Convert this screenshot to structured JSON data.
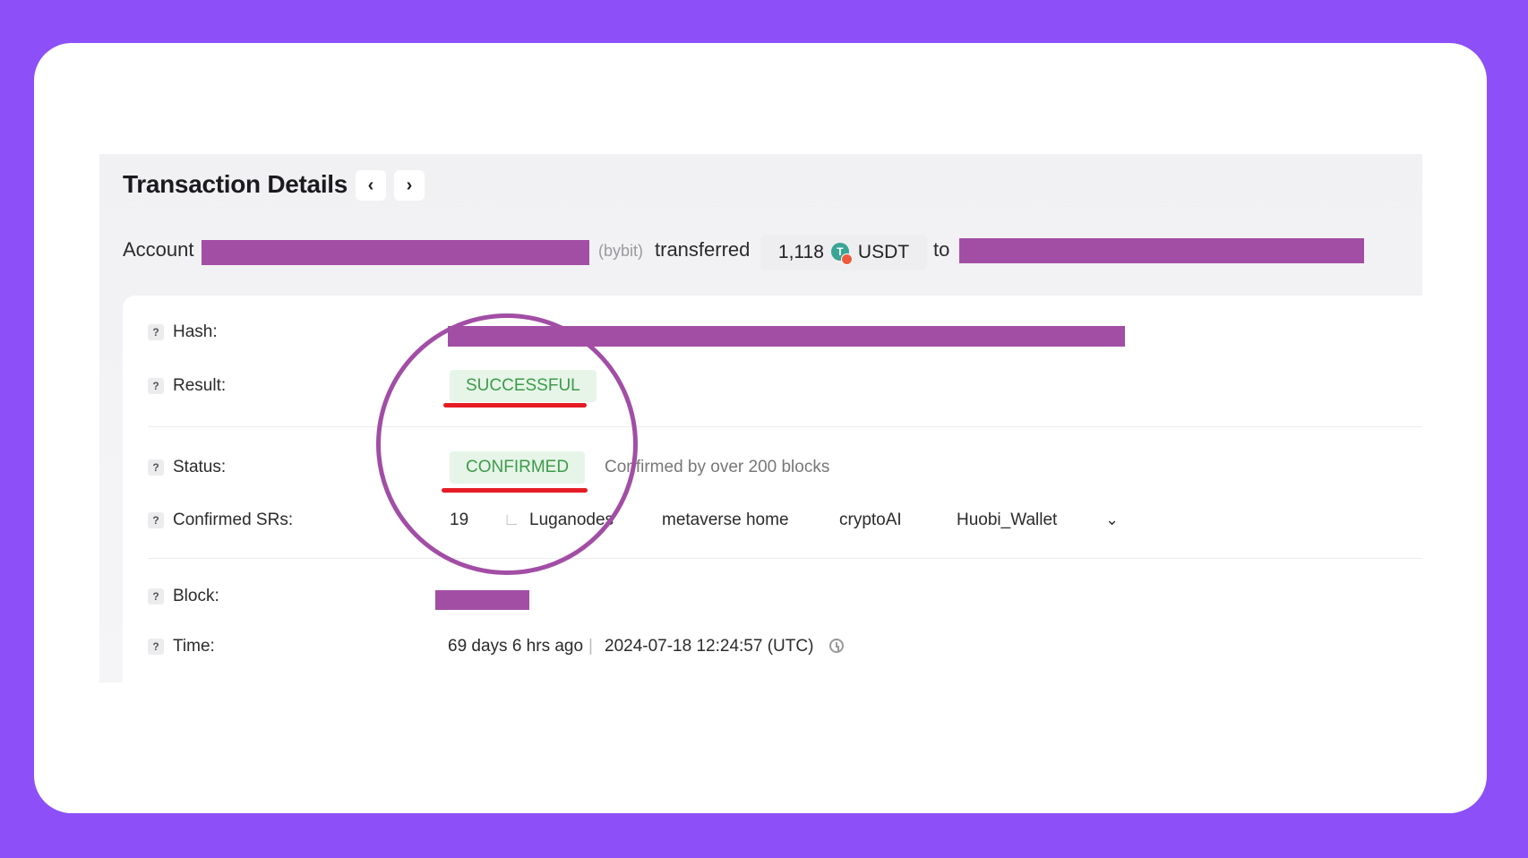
{
  "header": {
    "title": "Transaction Details",
    "prev_icon": "‹",
    "next_icon": "›"
  },
  "summary": {
    "account_label": "Account",
    "exchange_tag": "(bybit)",
    "transferred_label": "transferred",
    "amount": "1,118",
    "token": "USDT",
    "to_label": "to"
  },
  "rows": {
    "hash_label": "Hash:",
    "result_label": "Result:",
    "result_value": "SUCCESSFUL",
    "status_label": "Status:",
    "status_value": "CONFIRMED",
    "status_note": "Confirmed by over 200 blocks",
    "confirmed_srs_label": "Confirmed SRs:",
    "confirmed_srs_count": "19",
    "sr_names": [
      "Luganodes",
      "metaverse home",
      "cryptoAI",
      "Huobi_Wallet"
    ],
    "block_label": "Block:",
    "time_label": "Time:",
    "time_ago": "69 days 6 hrs ago",
    "time_separator": "|",
    "time_utc": "2024-07-18 12:24:57 (UTC)"
  },
  "colors": {
    "background": "#8c4ff8",
    "redaction": "#a24ea5",
    "success_bg": "#e6f5e8",
    "success_text": "#3d9b4a",
    "underline": "#e51c24"
  }
}
